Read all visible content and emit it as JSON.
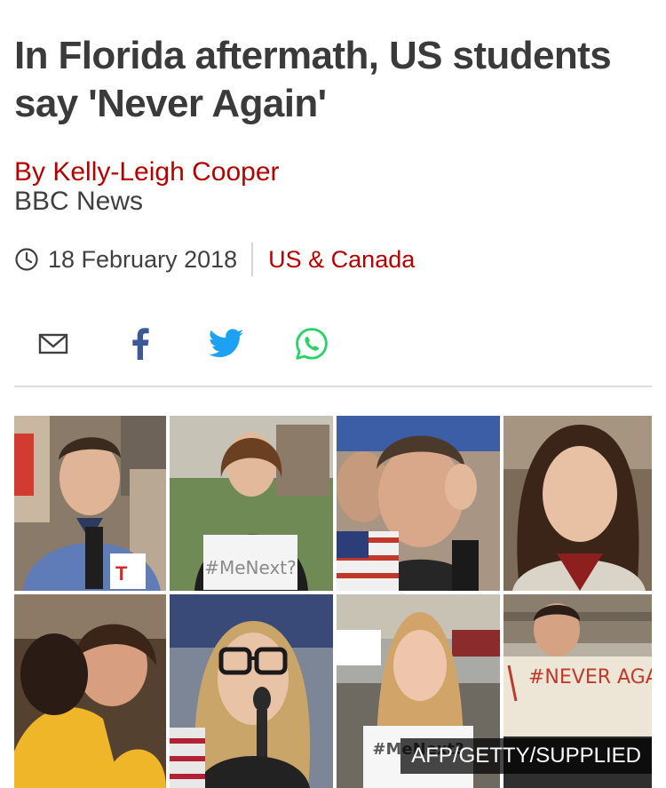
{
  "article": {
    "headline": "In Florida aftermath, US students say 'Never Again'",
    "byline": "By Kelly-Leigh Cooper",
    "outlet": "BBC News",
    "date": "18 February 2018",
    "section": "US & Canada"
  },
  "share": [
    {
      "name": "email-share-button",
      "icon": "mail-icon"
    },
    {
      "name": "facebook-share-button",
      "icon": "facebook-icon"
    },
    {
      "name": "twitter-share-button",
      "icon": "twitter-icon"
    },
    {
      "name": "whatsapp-share-button",
      "icon": "whatsapp-icon"
    }
  ],
  "photo": {
    "credit": "AFP/GETTY/SUPPLIED",
    "signs": {
      "sign1": "#MeNext?",
      "sign2": "#NEVER AGAIN",
      "sign3": "#MeNext?"
    }
  },
  "colors": {
    "accent": "#b80000",
    "facebook": "#3b5998",
    "twitter": "#1da1f2",
    "whatsapp": "#25d366"
  }
}
